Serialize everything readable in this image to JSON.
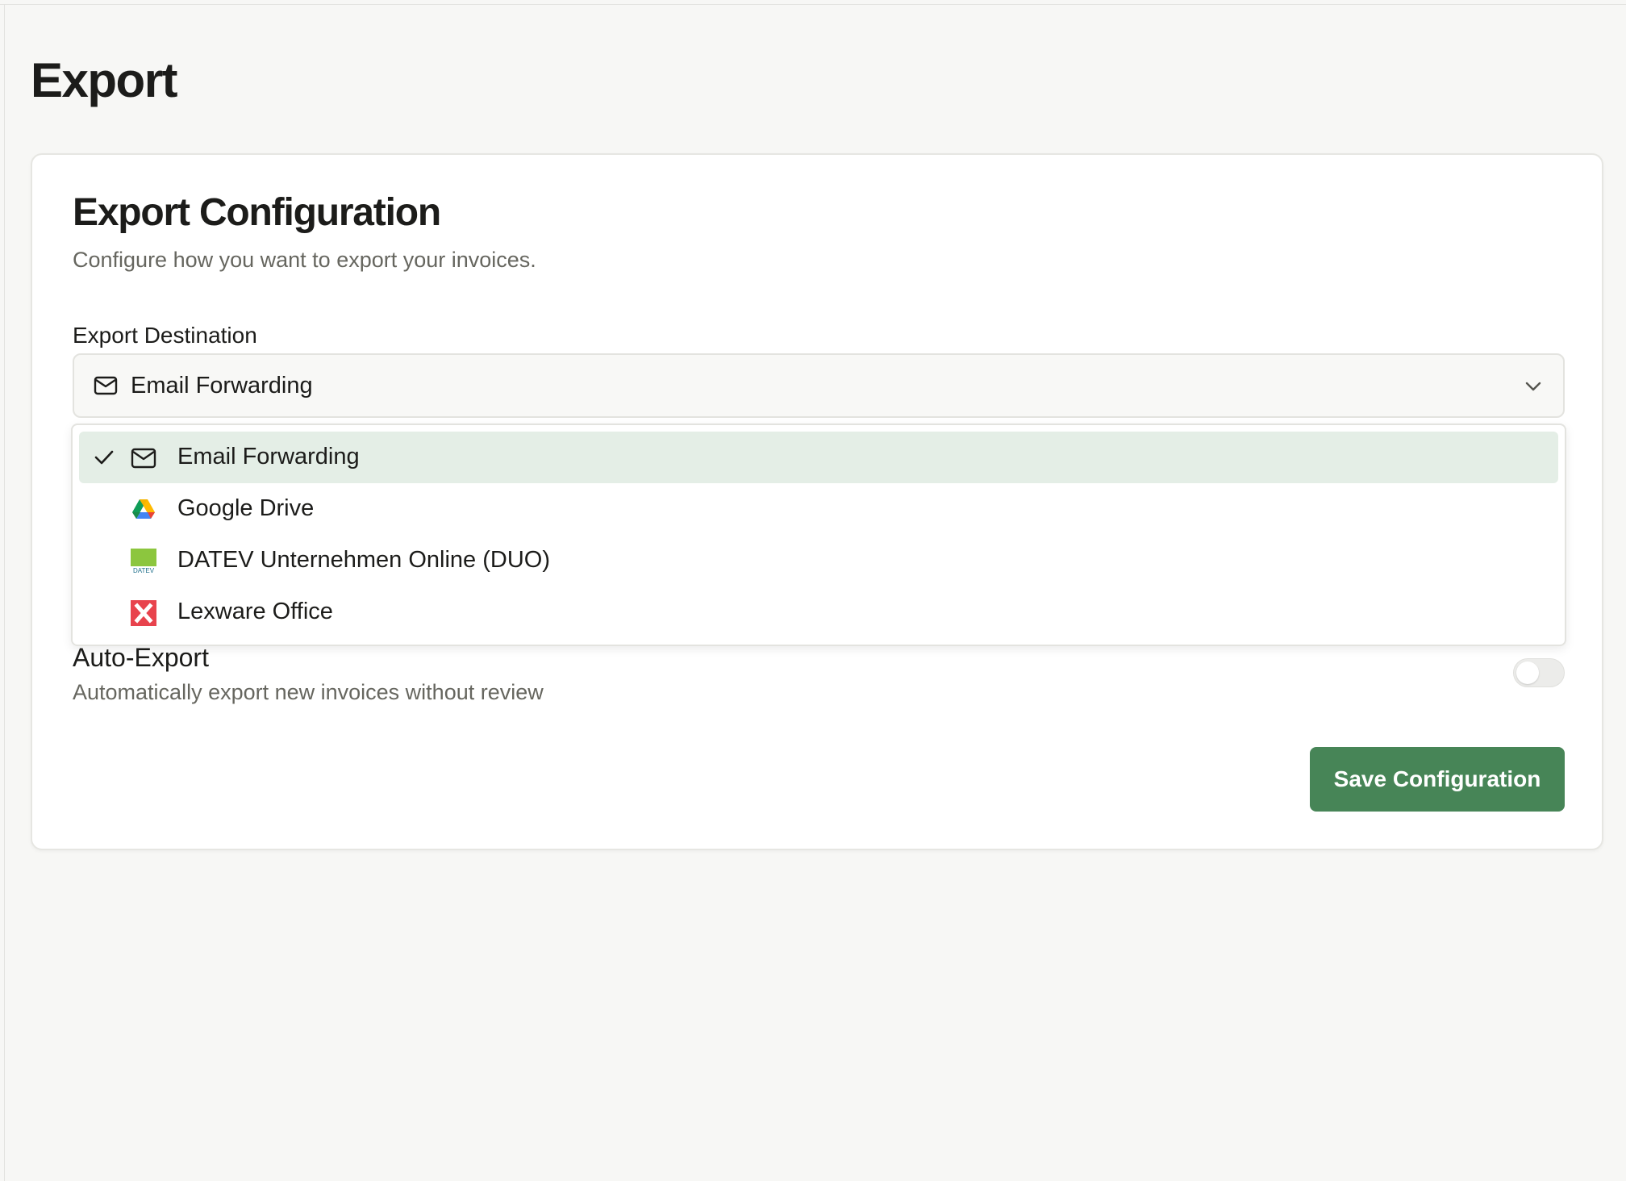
{
  "page": {
    "title": "Export"
  },
  "card": {
    "title": "Export Configuration",
    "subtitle": "Configure how you want to export your invoices."
  },
  "destination": {
    "label": "Export Destination",
    "selected": "Email Forwarding",
    "selected_icon": "mail-icon",
    "options": [
      {
        "label": "Email Forwarding",
        "icon": "mail-icon",
        "selected": true
      },
      {
        "label": "Google Drive",
        "icon": "google-drive-icon",
        "selected": false
      },
      {
        "label": "DATEV Unternehmen Online (DUO)",
        "icon": "datev-icon",
        "selected": false
      },
      {
        "label": "Lexware Office",
        "icon": "lexware-icon",
        "selected": false
      }
    ],
    "datev_logo_text": "DATEV"
  },
  "auto_export": {
    "title": "Auto-Export",
    "description": "Automatically export new invoices without review",
    "enabled": false
  },
  "actions": {
    "save_label": "Save Configuration"
  },
  "colors": {
    "primary": "#478557",
    "selected_option_bg": "#e4eee6",
    "background": "#f7f7f5",
    "datev_green": "#8cc63e",
    "lexware_red": "#e8434d"
  }
}
